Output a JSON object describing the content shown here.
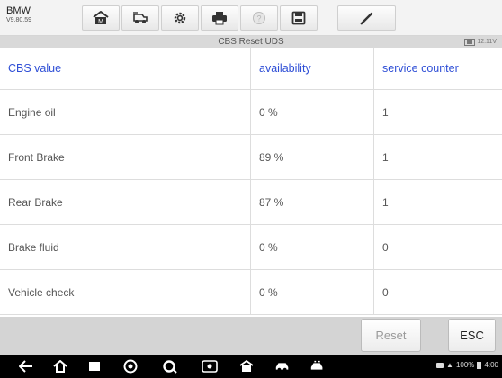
{
  "app": {
    "brand": "BMW",
    "version": "V9.80.59"
  },
  "toolbar": {
    "buttons": [
      {
        "icon": "home-icon"
      },
      {
        "icon": "car-swap-icon"
      },
      {
        "icon": "gear-icon"
      },
      {
        "icon": "print-icon"
      },
      {
        "icon": "help-icon"
      },
      {
        "icon": "save-icon"
      },
      {
        "icon": "pen-icon"
      }
    ]
  },
  "title_bar": {
    "title": "CBS Reset UDS",
    "voltage": "12.11V"
  },
  "table": {
    "headers": [
      "CBS value",
      "availability",
      "service counter"
    ],
    "rows": [
      [
        "Engine oil",
        "0 %",
        "1"
      ],
      [
        "Front Brake",
        "89 %",
        "1"
      ],
      [
        "Rear Brake",
        "87 %",
        "1"
      ],
      [
        "Brake fluid",
        "0 %",
        "0"
      ],
      [
        "Vehicle check",
        "0 %",
        "0"
      ]
    ]
  },
  "actions": {
    "reset_label": "Reset",
    "esc_label": "ESC"
  },
  "system_bar": {
    "battery_text": "100%",
    "time": "4:00"
  },
  "colors": {
    "header_text": "#2f4fd6",
    "toolbar_bg": "#f3f3f3",
    "title_bg": "#d9d9d9",
    "action_bar_bg": "#d4d4d4"
  }
}
